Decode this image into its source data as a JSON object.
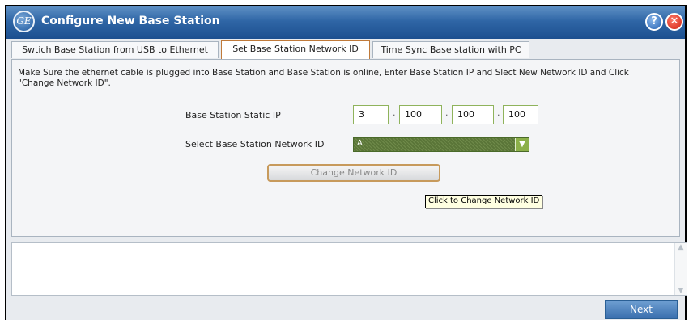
{
  "window": {
    "title": "Configure New Base Station",
    "help": "?",
    "close": "✕",
    "logo": "GE"
  },
  "tabs": [
    {
      "label": "Swtich Base Station from USB to Ethernet"
    },
    {
      "label": "Set Base Station Network ID"
    },
    {
      "label": "Time Sync Base station with PC"
    }
  ],
  "panel": {
    "instructions": "Make Sure the ethernet cable is plugged into Base Station and Base Station is online, Enter Base Station IP and Slect New Network ID and Click \"Change Network ID\".",
    "ip_label": "Base Station Static IP",
    "ip": [
      "3",
      "100",
      "100",
      "100"
    ],
    "ip_sep": "·",
    "network_label": "Select Base Station Network ID",
    "network_value": "A",
    "change_button": "Change Network ID",
    "tooltip": "Click to Change Network ID"
  },
  "footer": {
    "next": "Next"
  },
  "icons": {
    "help": "help-icon",
    "close": "close-icon",
    "dropdown": "chevron-down-icon"
  },
  "colors": {
    "titlebar": "#2f66a6",
    "accent": "#3a6fae",
    "field_border": "#8fb35c"
  }
}
